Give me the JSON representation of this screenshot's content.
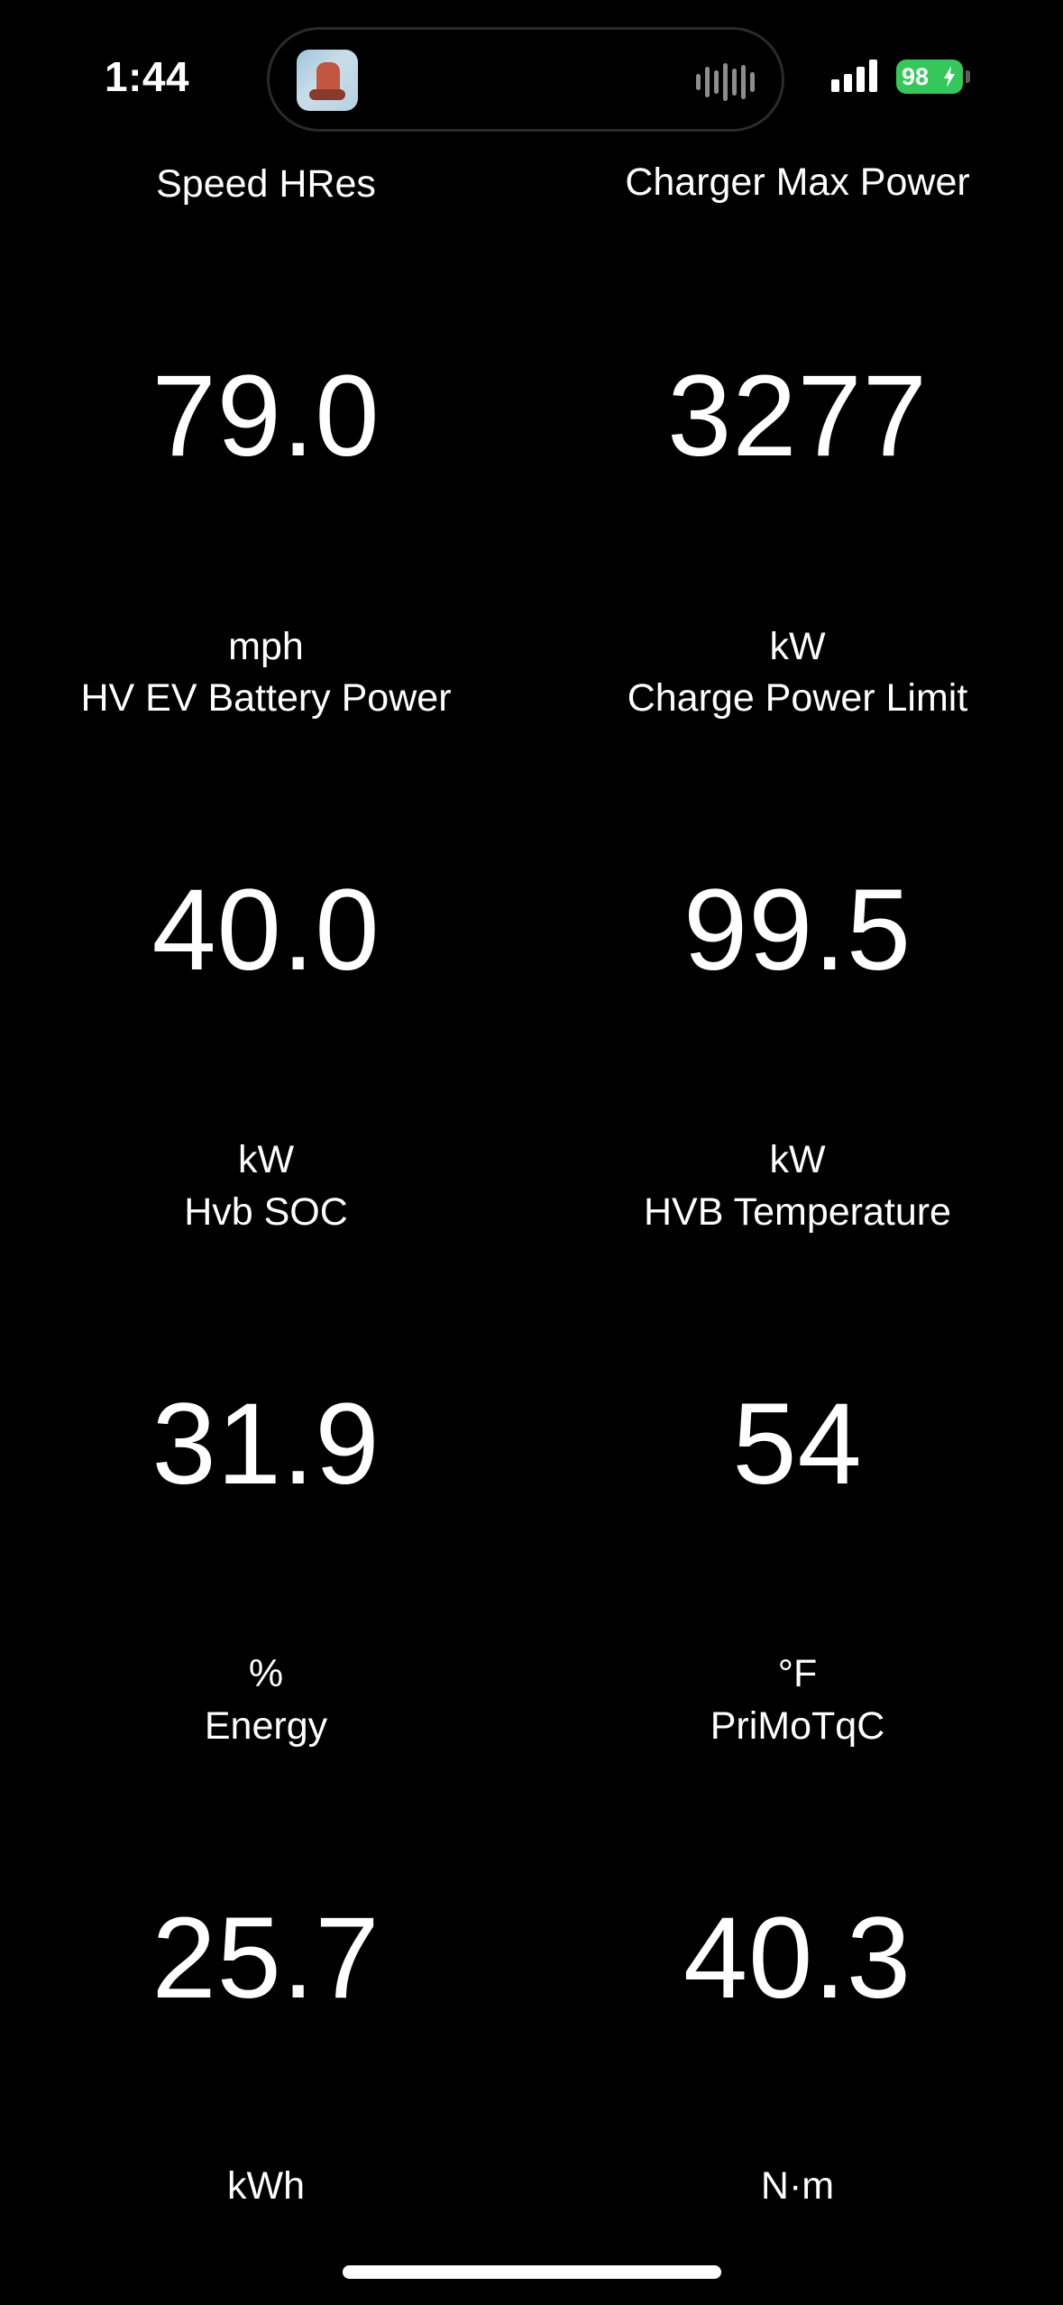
{
  "status_bar": {
    "time": "1:44",
    "battery_percent": "98",
    "signal_bars": 4
  },
  "metrics": {
    "speed": {
      "label": "Speed HRes",
      "value": "79.0",
      "unit": "mph"
    },
    "charger_max_power": {
      "label": "Charger Max Power",
      "value": "3277",
      "unit": "kW"
    },
    "hv_ev_battery_power": {
      "label": "HV EV Battery Power",
      "value": "40.0",
      "unit": "kW"
    },
    "charge_power_limit": {
      "label": "Charge Power Limit",
      "value": "99.5",
      "unit": "kW"
    },
    "hvb_soc": {
      "label": "Hvb SOC",
      "value": "31.9",
      "unit": "%"
    },
    "hvb_temperature": {
      "label": "HVB Temperature",
      "value": "54",
      "unit": "°F"
    },
    "energy": {
      "label": "Energy",
      "value": "25.7",
      "unit": "kWh"
    },
    "primotqc": {
      "label": "PriMoTqC",
      "value": "40.3",
      "unit": "N·m"
    }
  },
  "colors": {
    "background": "#000000",
    "text": "#ffffff",
    "battery": "#34c759"
  }
}
